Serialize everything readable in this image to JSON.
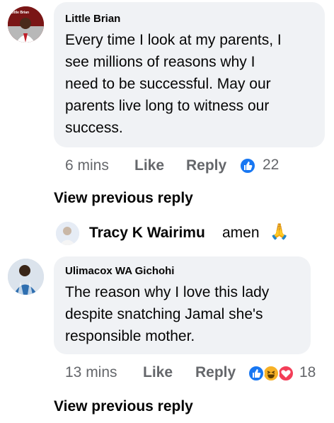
{
  "comments": [
    {
      "author": "Little Brian",
      "avatar_caption": "Little Brian",
      "text_lines": [
        "Every time I look at my parents, I",
        "see millions of reasons why I",
        "need to be successful. May our",
        "parents live long to witness our",
        "success."
      ],
      "time": "6 mins",
      "like_label": "Like",
      "reply_label": "Reply",
      "reaction_count": "22",
      "reactions": [
        "like-icon"
      ]
    },
    {
      "author": "Ulimacox WA Gichohi",
      "text_lines": [
        "The reason why I love this lady",
        "despite snatching Jamal she's",
        "responsible mother."
      ],
      "time": "13 mins",
      "like_label": "Like",
      "reply_label": "Reply",
      "reaction_count": "18",
      "reactions": [
        "like-icon",
        "haha-icon",
        "love-icon"
      ]
    }
  ],
  "reply_preview": {
    "author": "Tracy K Wairimu",
    "text": "amen",
    "emoji": "🙏"
  },
  "view_previous_label": "View previous reply",
  "colors": {
    "bubble": "#f0f2f5",
    "meta_text": "#65676b",
    "like_blue": "#1877f2",
    "love_red": "#f33e58",
    "haha_yellow": "#f7b125"
  }
}
